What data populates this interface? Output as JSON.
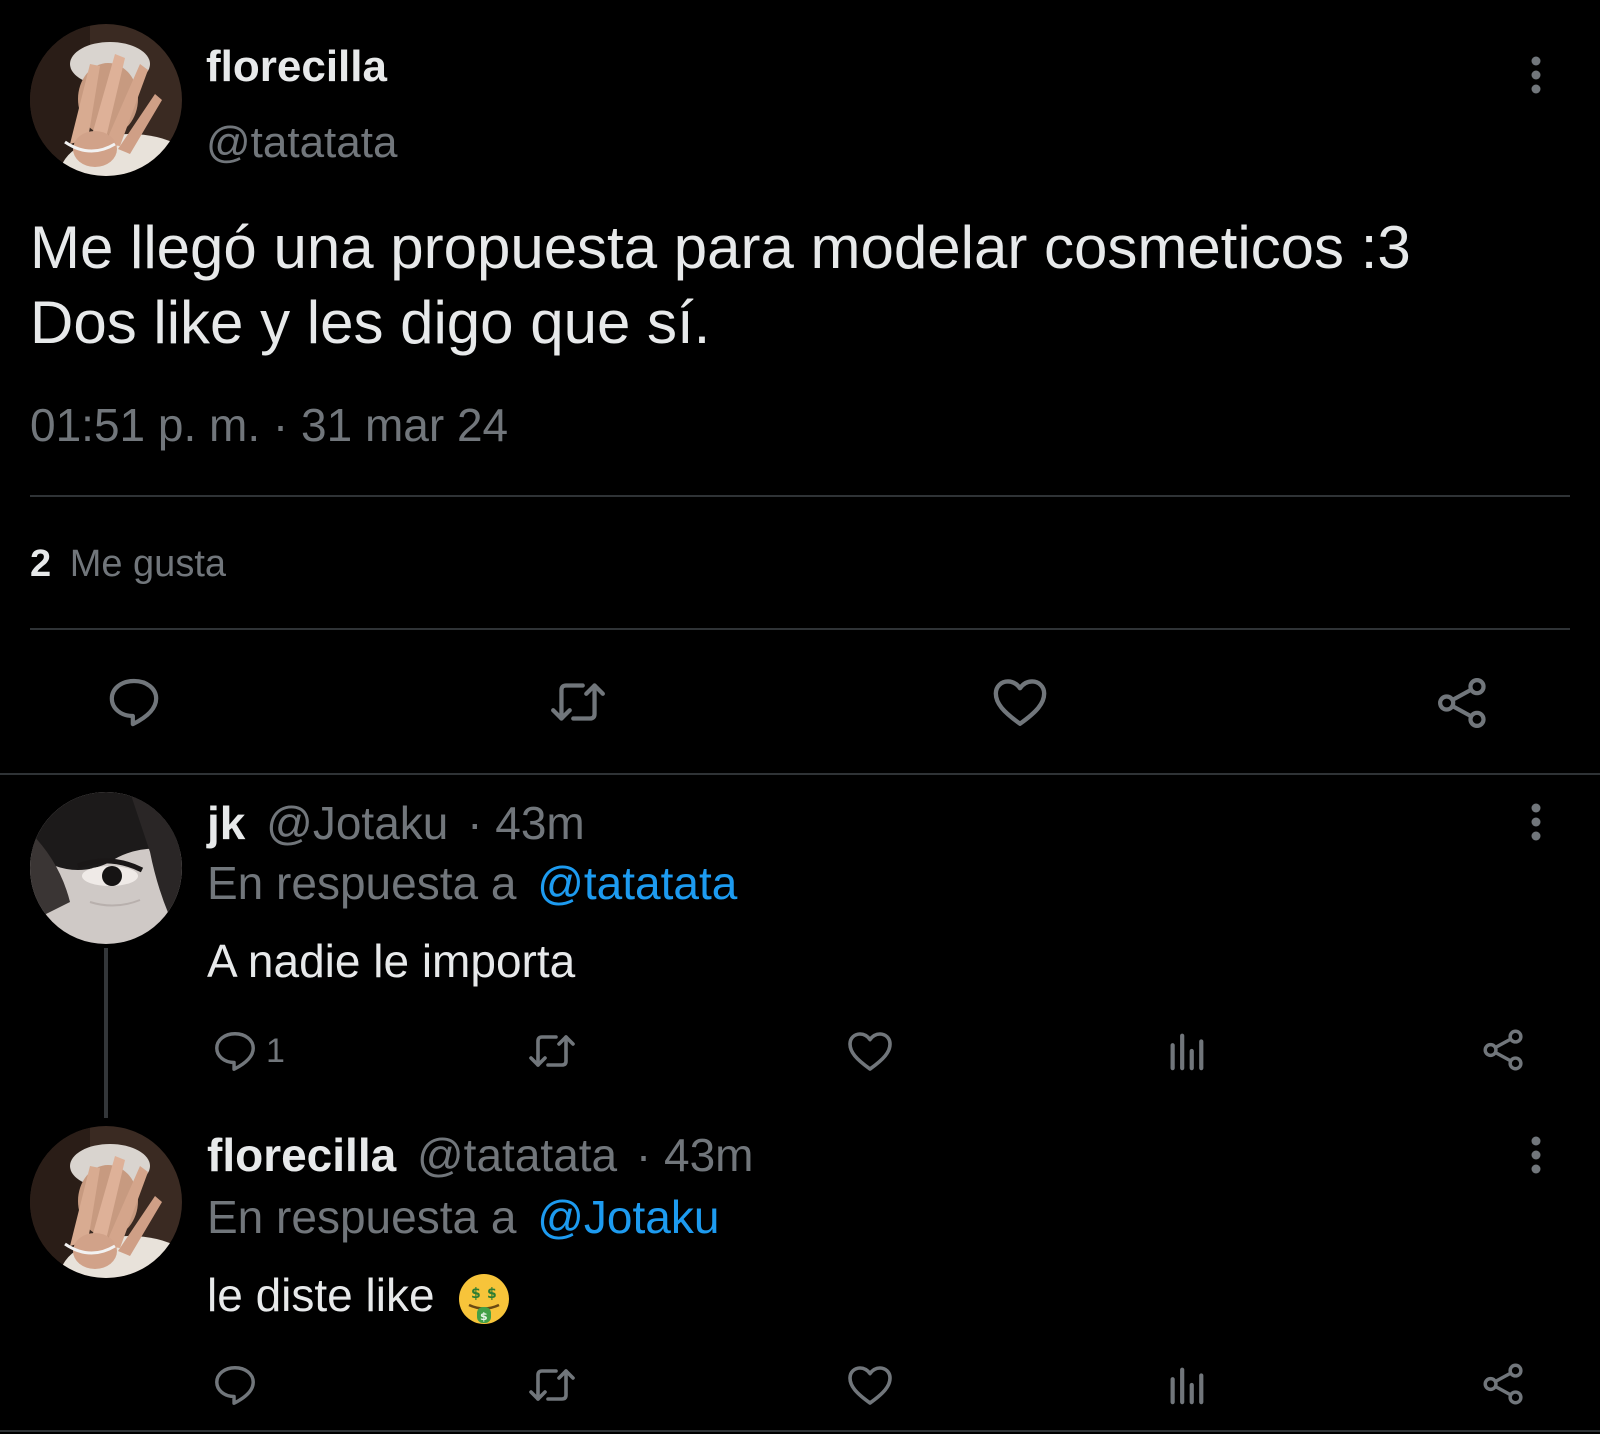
{
  "tweet": {
    "author_name": "florecilla",
    "author_handle": "@tatatata",
    "text_line1": "Me llegó una propuesta para modelar cosmeticos :3",
    "text_line2": "Dos like y les digo que sí.",
    "timestamp": "01:51 p. m. · 31 mar 24",
    "likes_count": "2",
    "likes_label": "Me gusta",
    "actions": [
      "reply-icon",
      "retweet-icon",
      "like-icon",
      "share-icon"
    ],
    "more_icon": "more-vertical-icon"
  },
  "replies": [
    {
      "author_name": "jk",
      "author_handle": "@Jotaku",
      "time": "· 43m",
      "reply_prefix": "En respuesta a",
      "reply_to": "@tatatata",
      "text": "A nadie le importa",
      "reply_count": "1",
      "actions": [
        "reply-icon",
        "retweet-icon",
        "like-icon",
        "views-icon",
        "share-icon"
      ]
    },
    {
      "author_name": "florecilla",
      "author_handle": "@tatatata",
      "time": "· 43m",
      "reply_prefix": "En respuesta a",
      "reply_to": "@Jotaku",
      "text": "le diste like",
      "emoji": "🤑",
      "emoji_icon": "money-mouth-face-icon",
      "actions": [
        "reply-icon",
        "retweet-icon",
        "like-icon",
        "views-icon",
        "share-icon"
      ]
    }
  ],
  "colors": {
    "background": "#000000",
    "text_primary": "#e7e9ea",
    "text_secondary": "#71767b",
    "link": "#1d9bf0",
    "divider": "#2f3336"
  }
}
